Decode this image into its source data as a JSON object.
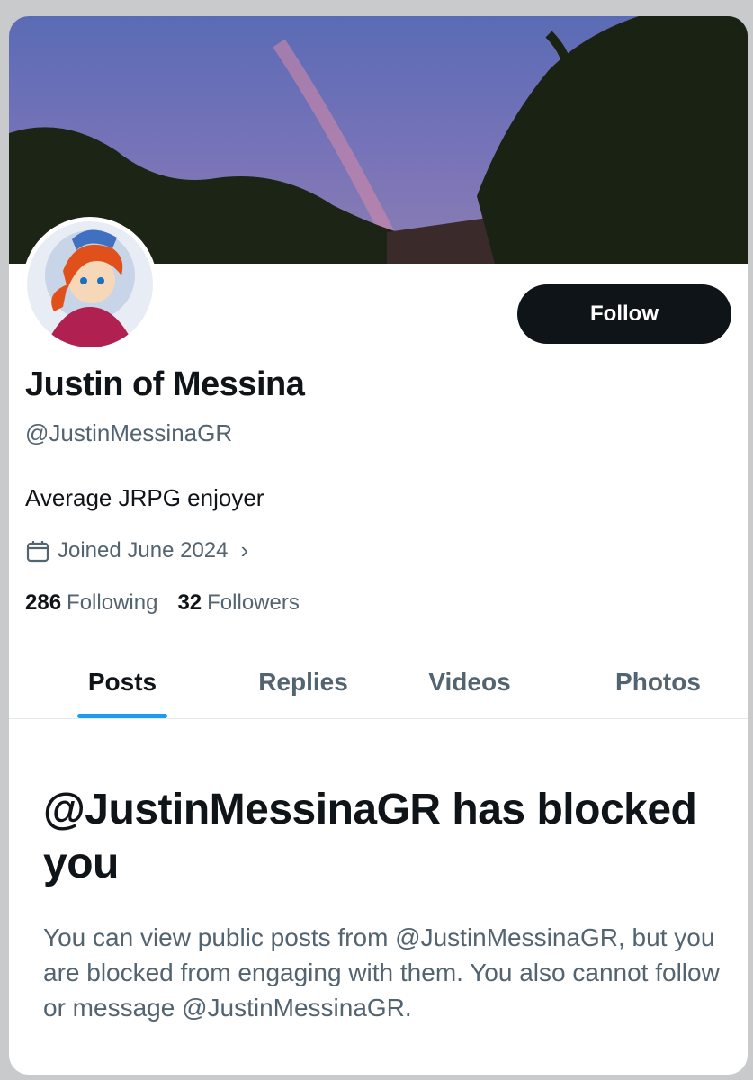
{
  "profile": {
    "display_name": "Justin of Messina",
    "handle": "@JustinMessinaGR",
    "bio": "Average JRPG enjoyer",
    "joined": "Joined June 2024",
    "following_count": "286",
    "following_label": "Following",
    "followers_count": "32",
    "followers_label": "Followers"
  },
  "actions": {
    "follow_label": "Follow"
  },
  "tabs": [
    {
      "label": "Posts",
      "active": true
    },
    {
      "label": "Replies",
      "active": false
    },
    {
      "label": "Videos",
      "active": false
    },
    {
      "label": "Photos",
      "active": false
    }
  ],
  "blocked_notice": {
    "title": "@JustinMessinaGR has blocked you",
    "message": "You can view public posts from @JustinMessinaGR, but you are blocked from engaging with them. You also cannot follow or message @JustinMessinaGR."
  },
  "icons": {
    "calendar": "calendar-icon",
    "chevron": "chevron-right-icon"
  },
  "colors": {
    "accent": "#1d9bf0",
    "text_primary": "#0f1419",
    "text_secondary": "#536471",
    "button_bg": "#0f1419"
  }
}
